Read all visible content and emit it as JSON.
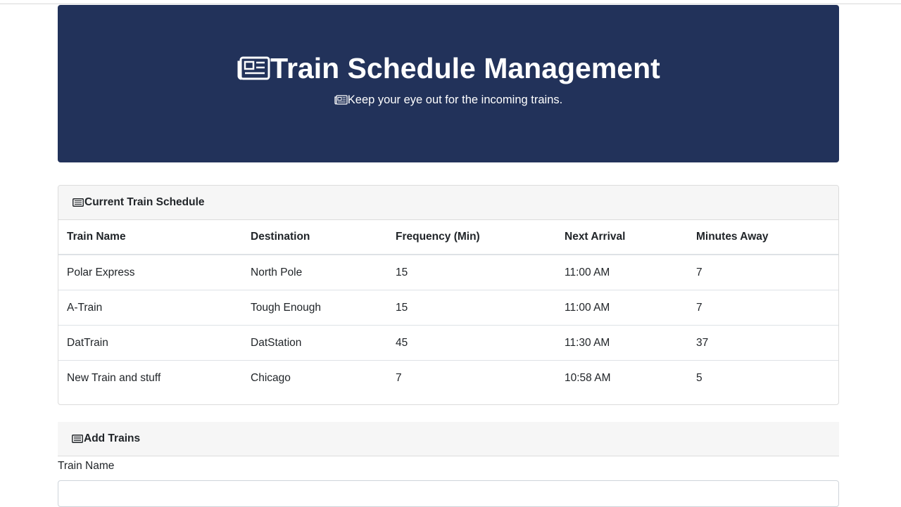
{
  "header": {
    "title": "Train Schedule Management",
    "subtitle": "Keep your eye out for the incoming trains.",
    "icon": "newspaper-icon",
    "background_color": "#22325a"
  },
  "schedule": {
    "heading": "Current Train Schedule",
    "icon": "list-icon",
    "columns": [
      "Train Name",
      "Destination",
      "Frequency (Min)",
      "Next Arrival",
      "Minutes Away"
    ],
    "rows": [
      [
        "Polar Express",
        "North Pole",
        "15",
        "11:00 AM",
        "7"
      ],
      [
        "A-Train",
        "Tough Enough",
        "15",
        "11:00 AM",
        "7"
      ],
      [
        "DatTrain",
        "DatStation",
        "45",
        "11:30 AM",
        "37"
      ],
      [
        "New Train and stuff",
        "Chicago",
        "7",
        "10:58 AM",
        "5"
      ]
    ]
  },
  "add_trains": {
    "heading": "Add Trains",
    "icon": "list-icon",
    "train_name_label": "Train Name",
    "train_name_value": ""
  }
}
